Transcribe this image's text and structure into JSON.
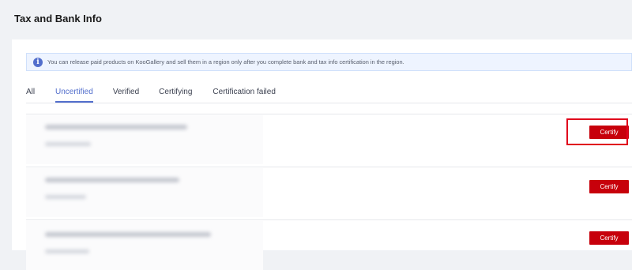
{
  "page": {
    "title": "Tax and Bank Info"
  },
  "notice": {
    "icon": "info-icon",
    "text": "You can release paid products on KooGallery and sell them in a region only after you complete bank and tax info certification in the region."
  },
  "tabs": [
    {
      "label": "All",
      "active": false
    },
    {
      "label": "Uncertified",
      "active": true
    },
    {
      "label": "Verified",
      "active": false
    },
    {
      "label": "Certifying",
      "active": false
    },
    {
      "label": "Certification failed",
      "active": false
    }
  ],
  "rows": [
    {
      "certify_label": "Certify",
      "highlighted": true
    },
    {
      "certify_label": "Certify",
      "highlighted": false
    },
    {
      "certify_label": "Certify",
      "highlighted": false
    }
  ],
  "colors": {
    "accent": "#526ecc",
    "certify_button": "#c7000b",
    "highlight": "#e0001b"
  }
}
